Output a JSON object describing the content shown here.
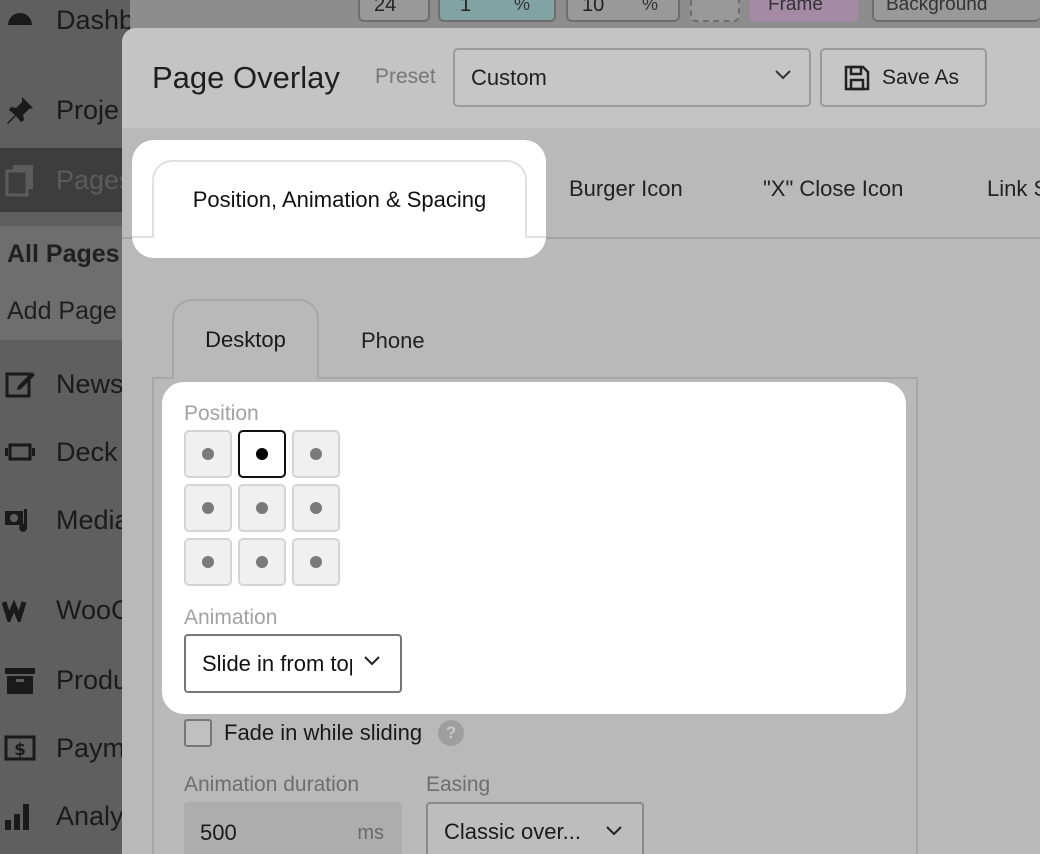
{
  "wp_menu": {
    "dashboard": "Dashboard",
    "projects": "Proje",
    "pages": "Pages",
    "all_pages": "All Pages",
    "add_page": "Add Page",
    "news": "News",
    "deck": "Deck",
    "media": "Media",
    "woo": "WooC",
    "products": "Produ",
    "payments": "Paym",
    "analytics": "Analy"
  },
  "toolbar": {
    "v1": "24",
    "v2": "1",
    "u2": "%",
    "v3": "10",
    "u3": "%",
    "frame": "Frame",
    "background": "Background"
  },
  "modal": {
    "title": "Page Overlay",
    "preset_label": "Preset",
    "preset_value": "Custom",
    "save_as": "Save As"
  },
  "tabs": [
    {
      "label": "Position, Animation & Spacing",
      "active": true
    },
    {
      "label": "Burger Icon"
    },
    {
      "label": "\"X\" Close Icon"
    },
    {
      "label": "Link S"
    }
  ],
  "device_tabs": {
    "desktop": "Desktop",
    "phone": "Phone"
  },
  "position": {
    "label": "Position",
    "selected": "top-center"
  },
  "animation": {
    "label": "Animation",
    "value": "Slide in from top"
  },
  "fade": {
    "label": "Fade in while sliding",
    "checked": false,
    "help": "?"
  },
  "duration": {
    "label": "Animation duration",
    "value": "500",
    "unit": "ms"
  },
  "easing": {
    "label": "Easing",
    "value": "Classic over..."
  }
}
